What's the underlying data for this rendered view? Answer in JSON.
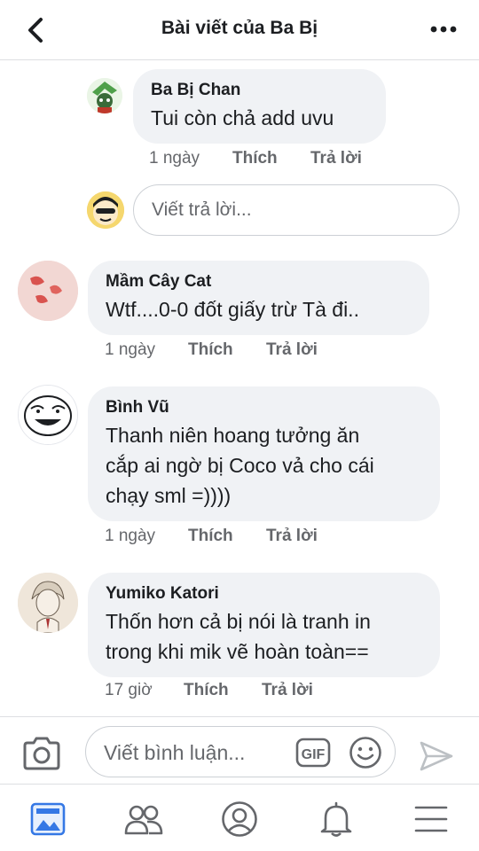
{
  "header": {
    "title": "Bài viết của Ba Bị"
  },
  "comments": [
    {
      "name": "Ba Bị Chan",
      "text": "Tui còn chả add uvu",
      "time": "1 ngày",
      "like": "Thích",
      "reply": "Trả lời"
    },
    {
      "name": "Mầm Cây Cat",
      "text": "Wtf....0-0 đốt giấy trừ Tà đi..",
      "time": "1 ngày",
      "like": "Thích",
      "reply": "Trả lời"
    },
    {
      "name": "Bình Vũ",
      "text_lines": [
        "Thanh niên hoang tưởng ăn",
        "cắp ai ngờ bị Coco vả cho cái",
        "chạy sml =))))"
      ],
      "time": "1 ngày",
      "like": "Thích",
      "reply": "Trả lời"
    },
    {
      "name": "Yumiko Katori",
      "text_lines": [
        "Thốn hơn cả bị nói là tranh in",
        "trong khi mik vẽ hoàn toàn=="
      ],
      "time": "17 giờ",
      "like": "Thích",
      "reply": "Trả lời"
    }
  ],
  "reply_input": {
    "placeholder": "Viết trả lời..."
  },
  "composer": {
    "placeholder": "Viết bình luận...",
    "gif_label": "GIF"
  },
  "icons": {
    "back": "chevron-left-icon",
    "more": "more-dots-icon",
    "camera": "camera-icon",
    "gif": "gif-icon",
    "emoji": "smiley-icon",
    "send": "send-icon",
    "tabs": [
      "news-feed-icon",
      "friends-icon",
      "profile-icon",
      "notifications-icon",
      "menu-icon"
    ]
  },
  "colors": {
    "accent": "#3578e5",
    "muted": "#65676b",
    "bubble": "#f0f2f5"
  }
}
